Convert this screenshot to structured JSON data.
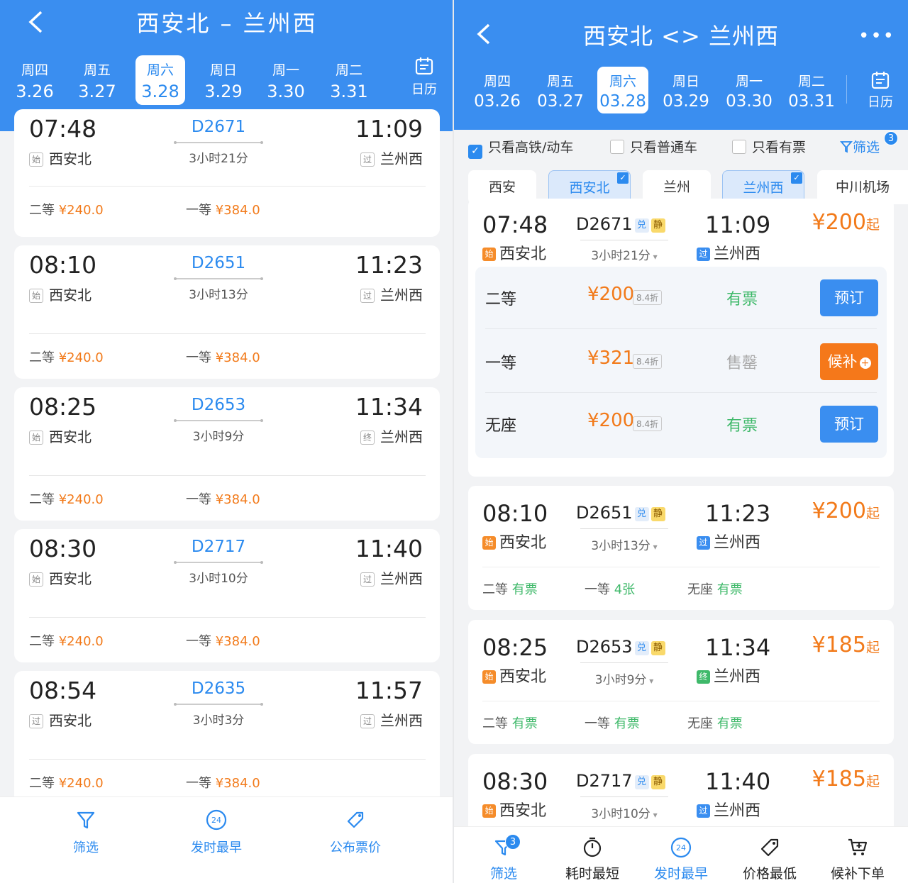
{
  "left": {
    "title": "西安北 – 兰州西",
    "dates": [
      {
        "weekday": "周四",
        "date": "3.26"
      },
      {
        "weekday": "周五",
        "date": "3.27"
      },
      {
        "weekday": "周六",
        "date": "3.28"
      },
      {
        "weekday": "周日",
        "date": "3.29"
      },
      {
        "weekday": "周一",
        "date": "3.30"
      },
      {
        "weekday": "周二",
        "date": "3.31"
      }
    ],
    "calendar_label": "日历",
    "trains": [
      {
        "dep": "07:48",
        "arr": "11:09",
        "code": "D2671",
        "duration": "3小时21分",
        "from_tag": "始",
        "from": "西安北",
        "to_tag": "过",
        "to": "兰州西",
        "s2_label": "二等",
        "s2_price": "¥240.0",
        "s1_label": "一等",
        "s1_price": "¥384.0"
      },
      {
        "dep": "08:10",
        "arr": "11:23",
        "code": "D2651",
        "duration": "3小时13分",
        "from_tag": "始",
        "from": "西安北",
        "to_tag": "过",
        "to": "兰州西",
        "s2_label": "二等",
        "s2_price": "¥240.0",
        "s1_label": "一等",
        "s1_price": "¥384.0"
      },
      {
        "dep": "08:25",
        "arr": "11:34",
        "code": "D2653",
        "duration": "3小时9分",
        "from_tag": "始",
        "from": "西安北",
        "to_tag": "终",
        "to": "兰州西",
        "s2_label": "二等",
        "s2_price": "¥240.0",
        "s1_label": "一等",
        "s1_price": "¥384.0"
      },
      {
        "dep": "08:30",
        "arr": "11:40",
        "code": "D2717",
        "duration": "3小时10分",
        "from_tag": "始",
        "from": "西安北",
        "to_tag": "过",
        "to": "兰州西",
        "s2_label": "二等",
        "s2_price": "¥240.0",
        "s1_label": "一等",
        "s1_price": "¥384.0"
      },
      {
        "dep": "08:54",
        "arr": "11:57",
        "code": "D2635",
        "duration": "3小时3分",
        "from_tag": "过",
        "from": "西安北",
        "to_tag": "过",
        "to": "兰州西",
        "s2_label": "二等",
        "s2_price": "¥240.0",
        "s1_label": "一等",
        "s1_price": "¥384.0"
      }
    ],
    "bottom_tabs": [
      "筛选",
      "发时最早",
      "公布票价"
    ],
    "clock_icon_text": "24"
  },
  "right": {
    "title": "西安北 <> 兰州西",
    "more": "•••",
    "dates": [
      {
        "weekday": "周四",
        "date": "03.26"
      },
      {
        "weekday": "周五",
        "date": "03.27"
      },
      {
        "weekday": "周六",
        "date": "03.28"
      },
      {
        "weekday": "周日",
        "date": "03.29"
      },
      {
        "weekday": "周一",
        "date": "03.30"
      },
      {
        "weekday": "周二",
        "date": "03.31"
      }
    ],
    "calendar_label": "日历",
    "checks": [
      {
        "label": "只看高铁/动车",
        "checked": true
      },
      {
        "label": "只看普通车",
        "checked": false
      },
      {
        "label": "只看有票",
        "checked": false
      }
    ],
    "filter_label": "筛选",
    "filter_count": "3",
    "stations": [
      {
        "name": "西安",
        "selected": false
      },
      {
        "name": "西安北",
        "selected": true
      },
      {
        "name": "兰州",
        "selected": false
      },
      {
        "name": "兰州西",
        "selected": true
      },
      {
        "name": "中川机场",
        "selected": false
      }
    ],
    "badge_exchange": "兑",
    "badge_quiet": "静",
    "price_suffix": "起",
    "first": {
      "dep": "07:48",
      "arr": "11:09",
      "code": "D2671",
      "duration": "3小时21分",
      "from_tag": "始",
      "from": "西安北",
      "to_tag": "过",
      "to": "兰州西",
      "price": "¥200",
      "seats": [
        {
          "name": "二等",
          "price": "¥200",
          "discount": "8.4折",
          "status": "有票",
          "button": "预订"
        },
        {
          "name": "一等",
          "price": "¥321",
          "discount": "8.4折",
          "status": "售罄",
          "button": "候补"
        },
        {
          "name": "无座",
          "price": "¥200",
          "discount": "8.4折",
          "status": "有票",
          "button": "预订"
        }
      ]
    },
    "trains": [
      {
        "dep": "08:10",
        "arr": "11:23",
        "code": "D2651",
        "duration": "3小时13分",
        "from_tag": "始",
        "from": "西安北",
        "to_tag": "过",
        "to": "兰州西",
        "price": "¥200",
        "seats": [
          {
            "label": "二等",
            "status": "有票"
          },
          {
            "label": "一等",
            "status": "4张"
          },
          {
            "label": "无座",
            "status": "有票"
          }
        ]
      },
      {
        "dep": "08:25",
        "arr": "11:34",
        "code": "D2653",
        "duration": "3小时9分",
        "from_tag": "始",
        "from": "西安北",
        "to_tag": "终",
        "to": "兰州西",
        "price": "¥185",
        "seats": [
          {
            "label": "二等",
            "status": "有票"
          },
          {
            "label": "一等",
            "status": "有票"
          },
          {
            "label": "无座",
            "status": "有票"
          }
        ]
      },
      {
        "dep": "08:30",
        "arr": "11:40",
        "code": "D2717",
        "duration": "3小时10分",
        "from_tag": "始",
        "from": "西安北",
        "to_tag": "过",
        "to": "兰州西",
        "price": "¥185"
      }
    ],
    "bottom_tabs": [
      {
        "label": "筛选",
        "badge": "3"
      },
      {
        "label": "耗时最短"
      },
      {
        "label": "发时最早"
      },
      {
        "label": "价格最低"
      },
      {
        "label": "候补下单"
      }
    ],
    "clock_icon_text": "24"
  }
}
